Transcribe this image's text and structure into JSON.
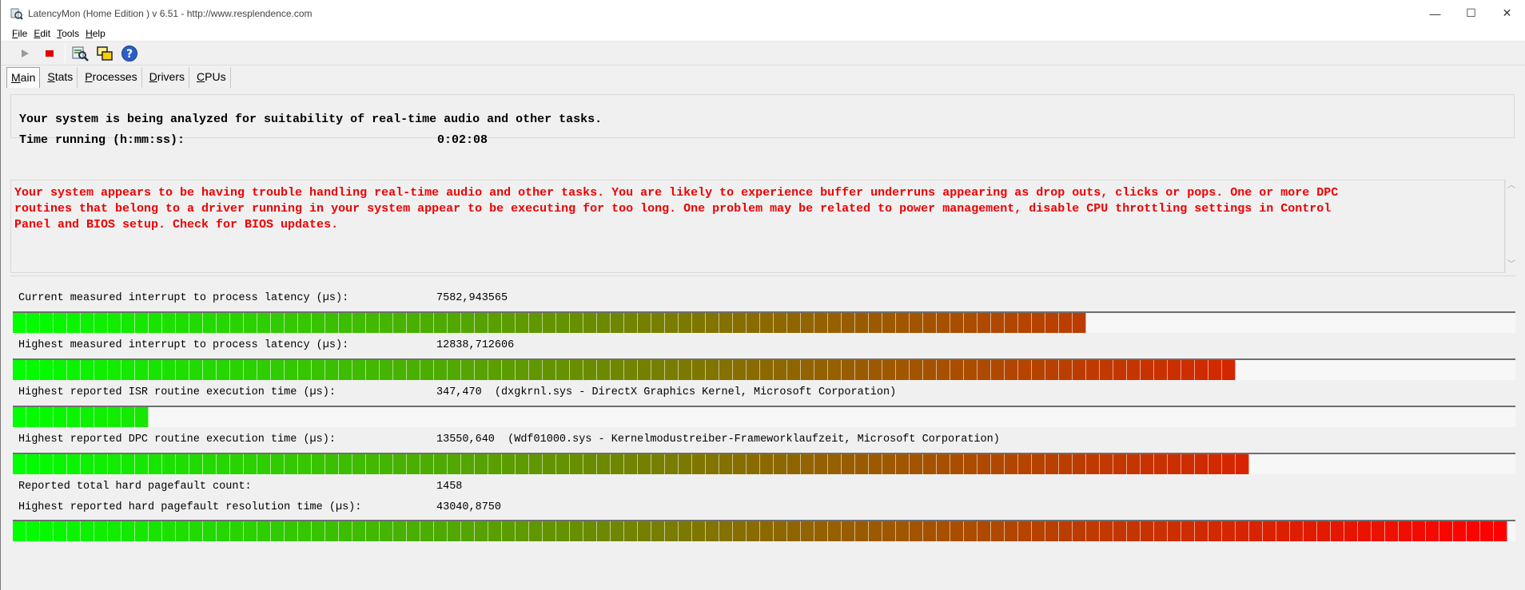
{
  "window": {
    "title": "LatencyMon  (Home Edition )  v 6.51 - http://www.resplendence.com",
    "controls": [
      "—",
      "☐",
      "✕"
    ]
  },
  "menu": {
    "items": [
      {
        "key": "F",
        "rest": "ile"
      },
      {
        "key": "E",
        "rest": "dit"
      },
      {
        "key": "T",
        "rest": "ools"
      },
      {
        "key": "H",
        "rest": "elp"
      }
    ]
  },
  "toolbar": {
    "icons": [
      "play-icon",
      "stop-icon",
      "analyze-icon",
      "windows-icon",
      "help-icon"
    ]
  },
  "tabs": [
    {
      "key": "M",
      "rest": "ain",
      "active": true
    },
    {
      "key": "S",
      "rest": "tats",
      "active": false
    },
    {
      "key": "P",
      "rest": "rocesses",
      "active": false
    },
    {
      "key": "D",
      "rest": "rivers",
      "active": false
    },
    {
      "key": "C",
      "rest": "PUs",
      "active": false
    }
  ],
  "status": {
    "line1": "Your system is being analyzed for suitability of real-time audio and other tasks.",
    "time_label": "Time running (h:mm:ss):",
    "time_value": "0:02:08"
  },
  "warning": {
    "line1": "Your system appears to be having trouble handling real-time audio and other tasks. You are likely to experience buffer underruns appearing as drop outs, clicks or pops. One or more DPC",
    "line2": "routines that belong to a driver running in your system appear to be executing for too long. One problem may be related to power management, disable CPU throttling settings in Control",
    "line3": "Panel and BIOS setup. Check for BIOS updates.",
    "color": "#ee0000"
  },
  "metrics": [
    {
      "label": "Current measured interrupt to process latency (µs):",
      "value": "7582,943565",
      "detail": "",
      "level": 0.715
    },
    {
      "label": "Highest measured interrupt to process latency (µs):",
      "value": "12838,712606",
      "detail": "",
      "level": 0.815
    },
    {
      "label": "Highest reported ISR routine execution time (µs):",
      "value": "347,470",
      "detail": "(dxgkrnl.sys - DirectX Graphics Kernel, Microsoft Corporation)",
      "level": 0.093
    },
    {
      "label": "Highest reported DPC routine execution time (µs):",
      "value": "13550,640",
      "detail": "(Wdf01000.sys - Kernelmodustreiber-Frameworklaufzeit, Microsoft Corporation)",
      "level": 0.83
    },
    {
      "label": "Reported total hard pagefault count:",
      "value": "1458",
      "detail": "",
      "level": null
    },
    {
      "label": "Highest reported hard pagefault resolution time (µs):",
      "value": "43040,8750",
      "detail": "",
      "level": 1.0
    }
  ],
  "colors": {
    "bar_start": "#00ff00",
    "bar_mid": "#8a6a00",
    "bar_end": "#ff0000"
  }
}
